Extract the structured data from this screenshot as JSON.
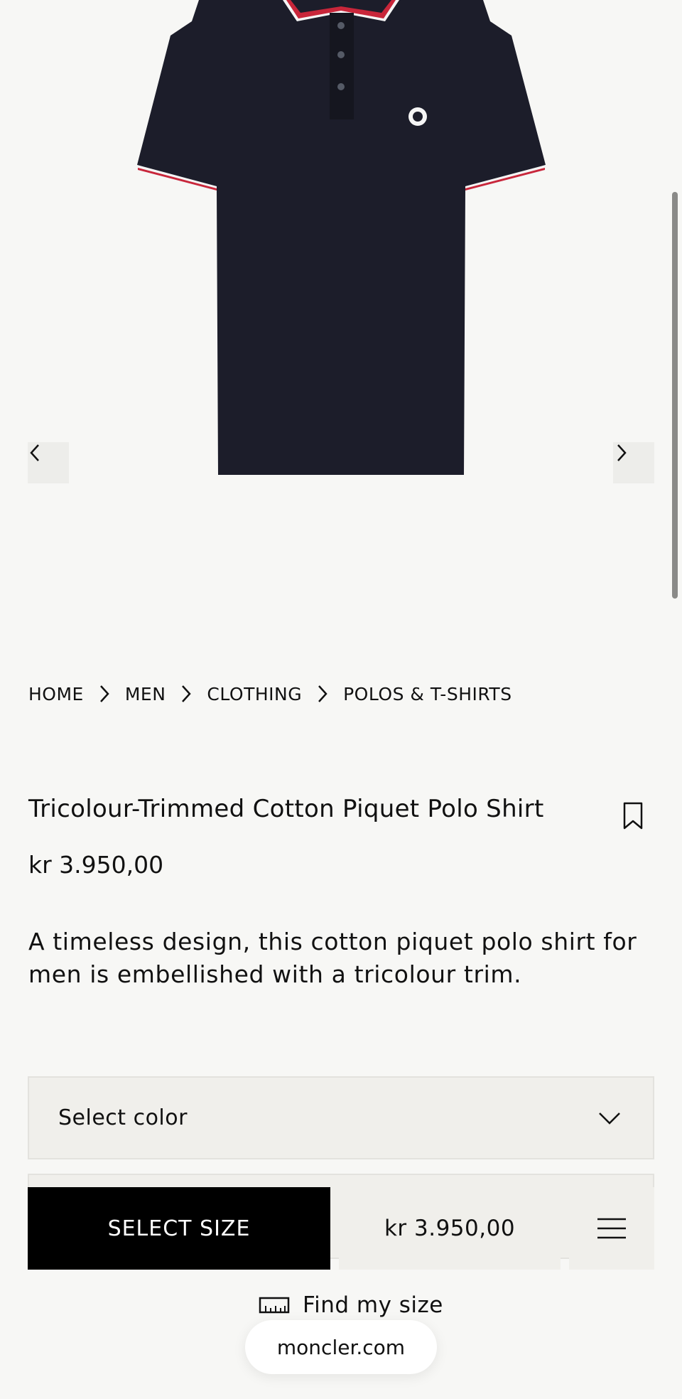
{
  "gallery": {
    "prev_icon": "chevron-left-icon",
    "next_icon": "chevron-right-icon"
  },
  "breadcrumb": {
    "items": [
      "HOME",
      "MEN",
      "CLOTHING",
      "POLOS & T-SHIRTS"
    ],
    "separator_icon": "chevron-right-icon"
  },
  "product": {
    "title": "Tricolour-Trimmed Cotton Piquet Polo Shirt",
    "price": "kr 3.950,00",
    "description": "A timeless design, this cotton piquet polo shirt for men is embellished with a tricolour trim.",
    "wishlist_icon": "bookmark-icon"
  },
  "color_select": {
    "label": "Select color",
    "icon": "chevron-down-icon"
  },
  "sticky_bar": {
    "select_size_label": "SELECT SIZE",
    "price": "kr 3.950,00",
    "menu_icon": "hamburger-icon"
  },
  "find_size": {
    "label": "Find my size",
    "icon": "ruler-icon"
  },
  "browser": {
    "url": "moncler.com"
  },
  "colors": {
    "shirt_navy": "#1c1d2a",
    "trim_red": "#c8263a",
    "trim_white": "#f5f5f5",
    "background": "#f7f7f5",
    "button_black": "#000000"
  }
}
